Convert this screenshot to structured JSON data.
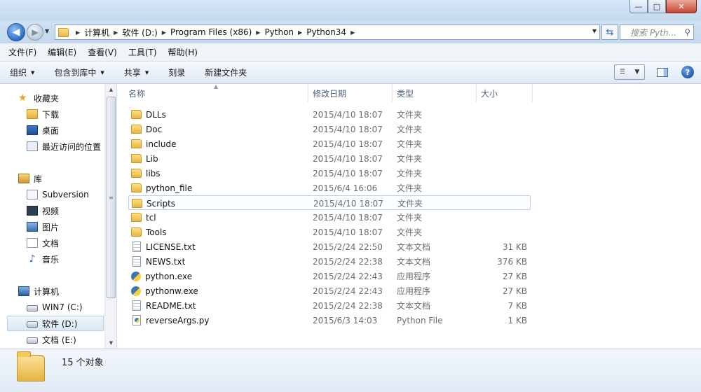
{
  "window": {
    "controls": {
      "minimize": "—",
      "maximize": "□",
      "close": "✕"
    }
  },
  "address": {
    "crumbs": [
      "计算机",
      "软件 (D:)",
      "Program Files (x86)",
      "Python",
      "Python34"
    ],
    "search_placeholder": "搜索 Pyth..."
  },
  "menu": [
    "文件(F)",
    "编辑(E)",
    "查看(V)",
    "工具(T)",
    "帮助(H)"
  ],
  "toolbar": {
    "organize": "组织",
    "include_library": "包含到库中",
    "share": "共享",
    "burn": "刻录",
    "new_folder": "新建文件夹"
  },
  "nav": {
    "favorites": "收藏夹",
    "downloads": "下载",
    "desktop": "桌面",
    "recent": "最近访问的位置",
    "libraries": "库",
    "subversion": "Subversion",
    "videos": "视频",
    "pictures": "图片",
    "documents": "文档",
    "music": "音乐",
    "computer": "计算机",
    "drive_c": "WIN7 (C:)",
    "drive_d": "软件 (D:)",
    "drive_e": "文档 (E:)"
  },
  "columns": {
    "name": "名称",
    "date": "修改日期",
    "type": "类型",
    "size": "大小"
  },
  "files": [
    {
      "name": "DLLs",
      "date": "2015/4/10 18:07",
      "type": "文件夹",
      "size": "",
      "icon": "folder-icon"
    },
    {
      "name": "Doc",
      "date": "2015/4/10 18:07",
      "type": "文件夹",
      "size": "",
      "icon": "folder-icon"
    },
    {
      "name": "include",
      "date": "2015/4/10 18:07",
      "type": "文件夹",
      "size": "",
      "icon": "folder-icon"
    },
    {
      "name": "Lib",
      "date": "2015/4/10 18:07",
      "type": "文件夹",
      "size": "",
      "icon": "folder-icon"
    },
    {
      "name": "libs",
      "date": "2015/4/10 18:07",
      "type": "文件夹",
      "size": "",
      "icon": "folder-icon"
    },
    {
      "name": "python_file",
      "date": "2015/6/4 16:06",
      "type": "文件夹",
      "size": "",
      "icon": "folder-icon"
    },
    {
      "name": "Scripts",
      "date": "2015/4/10 18:07",
      "type": "文件夹",
      "size": "",
      "icon": "folder-icon"
    },
    {
      "name": "tcl",
      "date": "2015/4/10 18:07",
      "type": "文件夹",
      "size": "",
      "icon": "folder-icon"
    },
    {
      "name": "Tools",
      "date": "2015/4/10 18:07",
      "type": "文件夹",
      "size": "",
      "icon": "folder-icon"
    },
    {
      "name": "LICENSE.txt",
      "date": "2015/2/24 22:50",
      "type": "文本文档",
      "size": "31 KB",
      "icon": "text-file-icon"
    },
    {
      "name": "NEWS.txt",
      "date": "2015/2/24 22:38",
      "type": "文本文档",
      "size": "376 KB",
      "icon": "text-file-icon"
    },
    {
      "name": "python.exe",
      "date": "2015/2/24 22:43",
      "type": "应用程序",
      "size": "27 KB",
      "icon": "python-exe-icon"
    },
    {
      "name": "pythonw.exe",
      "date": "2015/2/24 22:43",
      "type": "应用程序",
      "size": "27 KB",
      "icon": "python-exe-icon"
    },
    {
      "name": "README.txt",
      "date": "2015/2/24 22:38",
      "type": "文本文档",
      "size": "7 KB",
      "icon": "text-file-icon"
    },
    {
      "name": "reverseArgs.py",
      "date": "2015/6/3 14:03",
      "type": "Python File",
      "size": "1 KB",
      "icon": "python-file-icon"
    }
  ],
  "status": {
    "count": "15 个对象"
  }
}
